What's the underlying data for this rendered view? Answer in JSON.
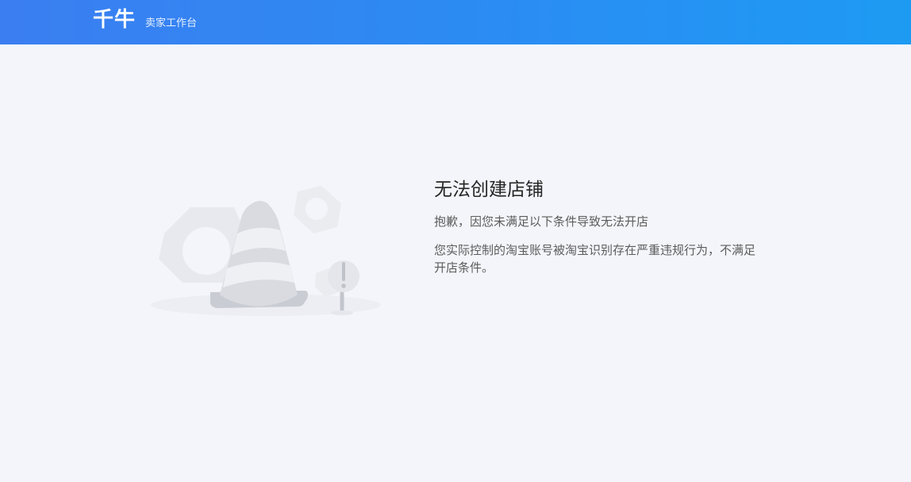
{
  "header": {
    "logo": "千牛",
    "subtitle": "卖家工作台"
  },
  "error": {
    "title": "无法创建店铺",
    "description": "抱歉，因您未满足以下条件导致无法开店",
    "reason": "您实际控制的淘宝账号被淘宝识别存在严重违规行为，不满足开店条件。"
  },
  "illustration": {
    "icon": "traffic-cone-warning-icon"
  },
  "colors": {
    "header_start": "#3b7ef1",
    "header_end": "#1d9bf3",
    "background": "#f4f5fa"
  }
}
